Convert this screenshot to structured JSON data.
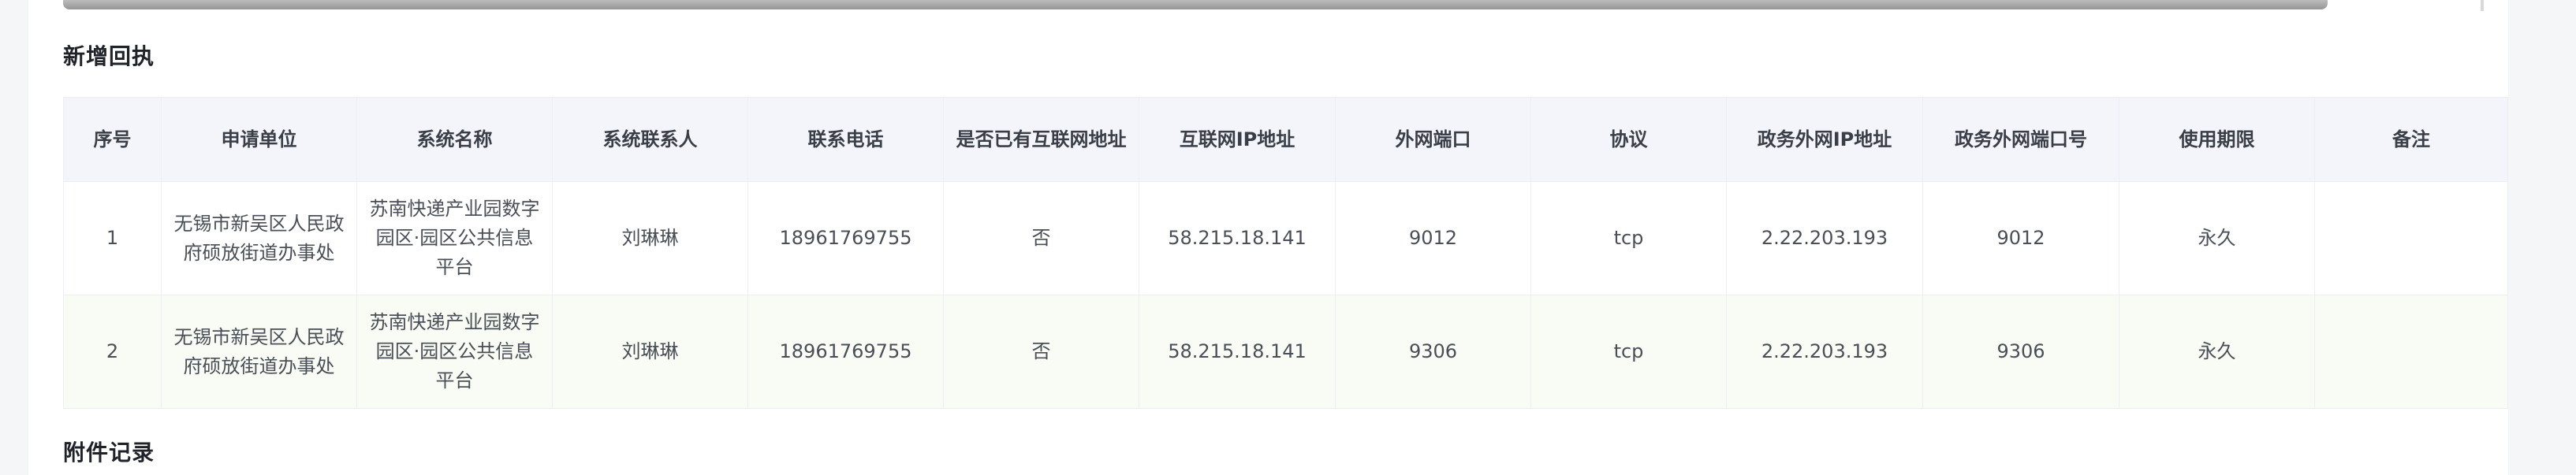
{
  "section_titles": {
    "new_receipt": "新增回执",
    "attachments": "附件记录"
  },
  "table": {
    "headers": [
      "序号",
      "申请单位",
      "系统名称",
      "系统联系人",
      "联系电话",
      "是否已有互联网地址",
      "互联网IP地址",
      "外网端口",
      "协议",
      "政务外网IP地址",
      "政务外网端口号",
      "使用期限",
      "备注"
    ],
    "rows": [
      [
        "1",
        "无锡市新吴区人民政府硕放街道办事处",
        "苏南快递产业园数字园区·园区公共信息平台",
        "刘琳琳",
        "18961769755",
        "否",
        "58.215.18.141",
        "9012",
        "tcp",
        "2.22.203.193",
        "9012",
        "永久",
        ""
      ],
      [
        "2",
        "无锡市新吴区人民政府硕放街道办事处",
        "苏南快递产业园数字园区·园区公共信息平台",
        "刘琳琳",
        "18961769755",
        "否",
        "58.215.18.141",
        "9306",
        "tcp",
        "2.22.203.193",
        "9306",
        "永久",
        ""
      ]
    ]
  }
}
